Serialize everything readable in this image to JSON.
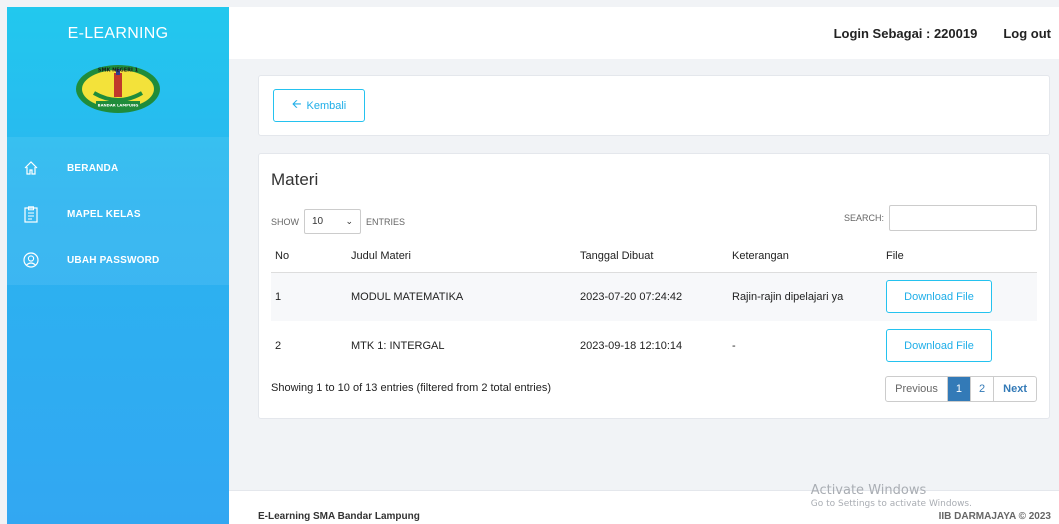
{
  "sidebar": {
    "brand": "E-LEARNING",
    "logo_text_top": "SMK NEGERI 1",
    "logo_text_bottom": "BANDAR LAMPUNG",
    "items": [
      {
        "label": "BERANDA",
        "icon": "home-icon"
      },
      {
        "label": "MAPEL KELAS",
        "icon": "clipboard-icon"
      },
      {
        "label": "UBAH PASSWORD",
        "icon": "user-icon"
      }
    ],
    "colors": {
      "top": "#22c8ee",
      "bottom": "#32a7f2"
    }
  },
  "topbar": {
    "login_label": "Login Sebagai : 220019",
    "logout_label": "Log out"
  },
  "back_button": {
    "label": "Kembali",
    "icon": "arrow-left-icon"
  },
  "main": {
    "title": "Materi",
    "show_label": "SHOW",
    "entries_value": "10",
    "entries_label": "ENTRIES",
    "search_label": "SEARCH:",
    "columns": [
      "No",
      "Judul Materi",
      "Tanggal Dibuat",
      "Keterangan",
      "File"
    ],
    "rows": [
      {
        "no": "1",
        "judul": "MODUL MATEMATIKA",
        "tanggal": "2023-07-20 07:24:42",
        "keterangan": "Rajin-rajin dipelajari ya",
        "file": "Download File"
      },
      {
        "no": "2",
        "judul": "MTK 1: INTERGAL",
        "tanggal": "2023-09-18 12:10:14",
        "keterangan": "-",
        "file": "Download File"
      }
    ],
    "info": "Showing 1 to 10 of 13 entries (filtered from 2 total entries)",
    "pagination": {
      "previous": "Previous",
      "pages": [
        "1",
        "2"
      ],
      "active": "1",
      "next": "Next"
    }
  },
  "footer": {
    "left": "E-Learning SMA Bandar Lampung",
    "right": "IIB DARMAJAYA © 2023"
  },
  "watermark": {
    "line1": "Activate Windows",
    "line2": "Go to Settings to activate Windows."
  },
  "accent_color": "#24c2ef"
}
